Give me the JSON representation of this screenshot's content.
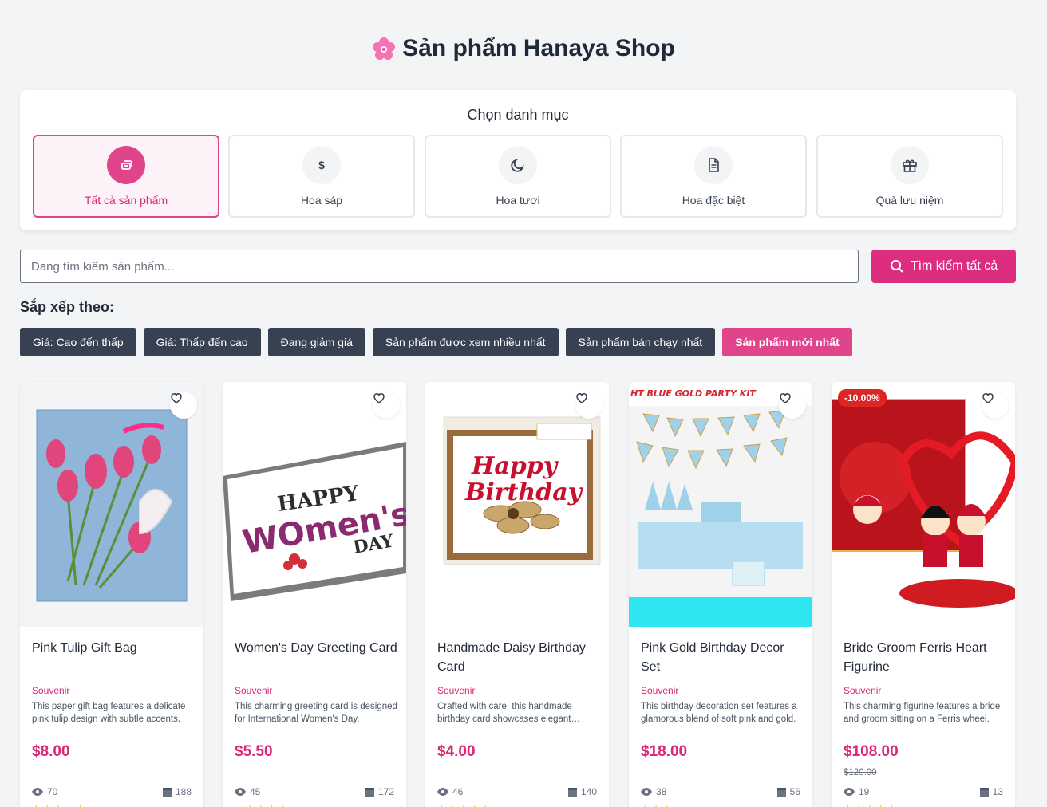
{
  "page": {
    "title": "Sản phẩm Hanaya Shop",
    "title_icon": "cherry-blossom-icon"
  },
  "categories": {
    "heading": "Chọn danh mục",
    "items": [
      {
        "label": "Tất cả sản phẩm",
        "icon": "layers-icon",
        "active": true
      },
      {
        "label": "Hoa sáp",
        "icon": "dollar-icon",
        "active": false
      },
      {
        "label": "Hoa tươi",
        "icon": "moon-icon",
        "active": false
      },
      {
        "label": "Hoa đặc biệt",
        "icon": "document-icon",
        "active": false
      },
      {
        "label": "Quà lưu niệm",
        "icon": "gift-icon",
        "active": false
      }
    ]
  },
  "search": {
    "placeholder": "Đang tìm kiếm sản phẩm...",
    "button_label": "Tìm kiếm tất cả"
  },
  "sort": {
    "label": "Sắp xếp theo:",
    "options": [
      {
        "label": "Giá: Cao đến thấp",
        "active": false
      },
      {
        "label": "Giá: Thấp đến cao",
        "active": false
      },
      {
        "label": "Đang giảm giá",
        "active": false
      },
      {
        "label": "Sản phẩm được xem nhiều nhất",
        "active": false
      },
      {
        "label": "Sản phẩm bán chạy nhất",
        "active": false
      },
      {
        "label": "Sản phẩm mới nhất",
        "active": true
      }
    ]
  },
  "products": [
    {
      "name": "Pink Tulip Gift Bag",
      "category": "Souvenir",
      "description": "This paper gift bag features a delicate pink tulip design with subtle accents.",
      "price": "$8.00",
      "views": "70",
      "sold": "188"
    },
    {
      "name": "Women's Day Greeting Card",
      "category": "Souvenir",
      "description": "This charming greeting card is designed for International Women's Day.",
      "price": "$5.50",
      "views": "45",
      "sold": "172",
      "image_text": {
        "line1": "HAPPY",
        "line2": "WOmen's",
        "line3": "DAY"
      }
    },
    {
      "name": "Handmade Daisy Birthday Card",
      "category": "Souvenir",
      "description": "Crafted with care, this handmade birthday card showcases elegant details.",
      "price": "$4.00",
      "views": "46",
      "sold": "140",
      "image_text": {
        "line1": "Happy",
        "line2": "Birthday"
      }
    },
    {
      "name": "Pink Gold Birthday Decor Set",
      "category": "Souvenir",
      "description": "This birthday decoration set features a glamorous blend of soft pink and gold.",
      "price": "$18.00",
      "views": "38",
      "sold": "56",
      "image_text": {
        "banner": "HT BLUE GOLD PARTY KIT"
      }
    },
    {
      "name": "Bride Groom Ferris Heart Figurine",
      "category": "Souvenir",
      "description": "This charming figurine features a bride and groom sitting on a Ferris wheel.",
      "price": "$108.00",
      "old_price": "$120.00",
      "discount": "-10.00%",
      "views": "19",
      "sold": "13"
    }
  ],
  "colors": {
    "accent": "#e0458b",
    "dark_button": "#374151",
    "price": "#db2777"
  }
}
